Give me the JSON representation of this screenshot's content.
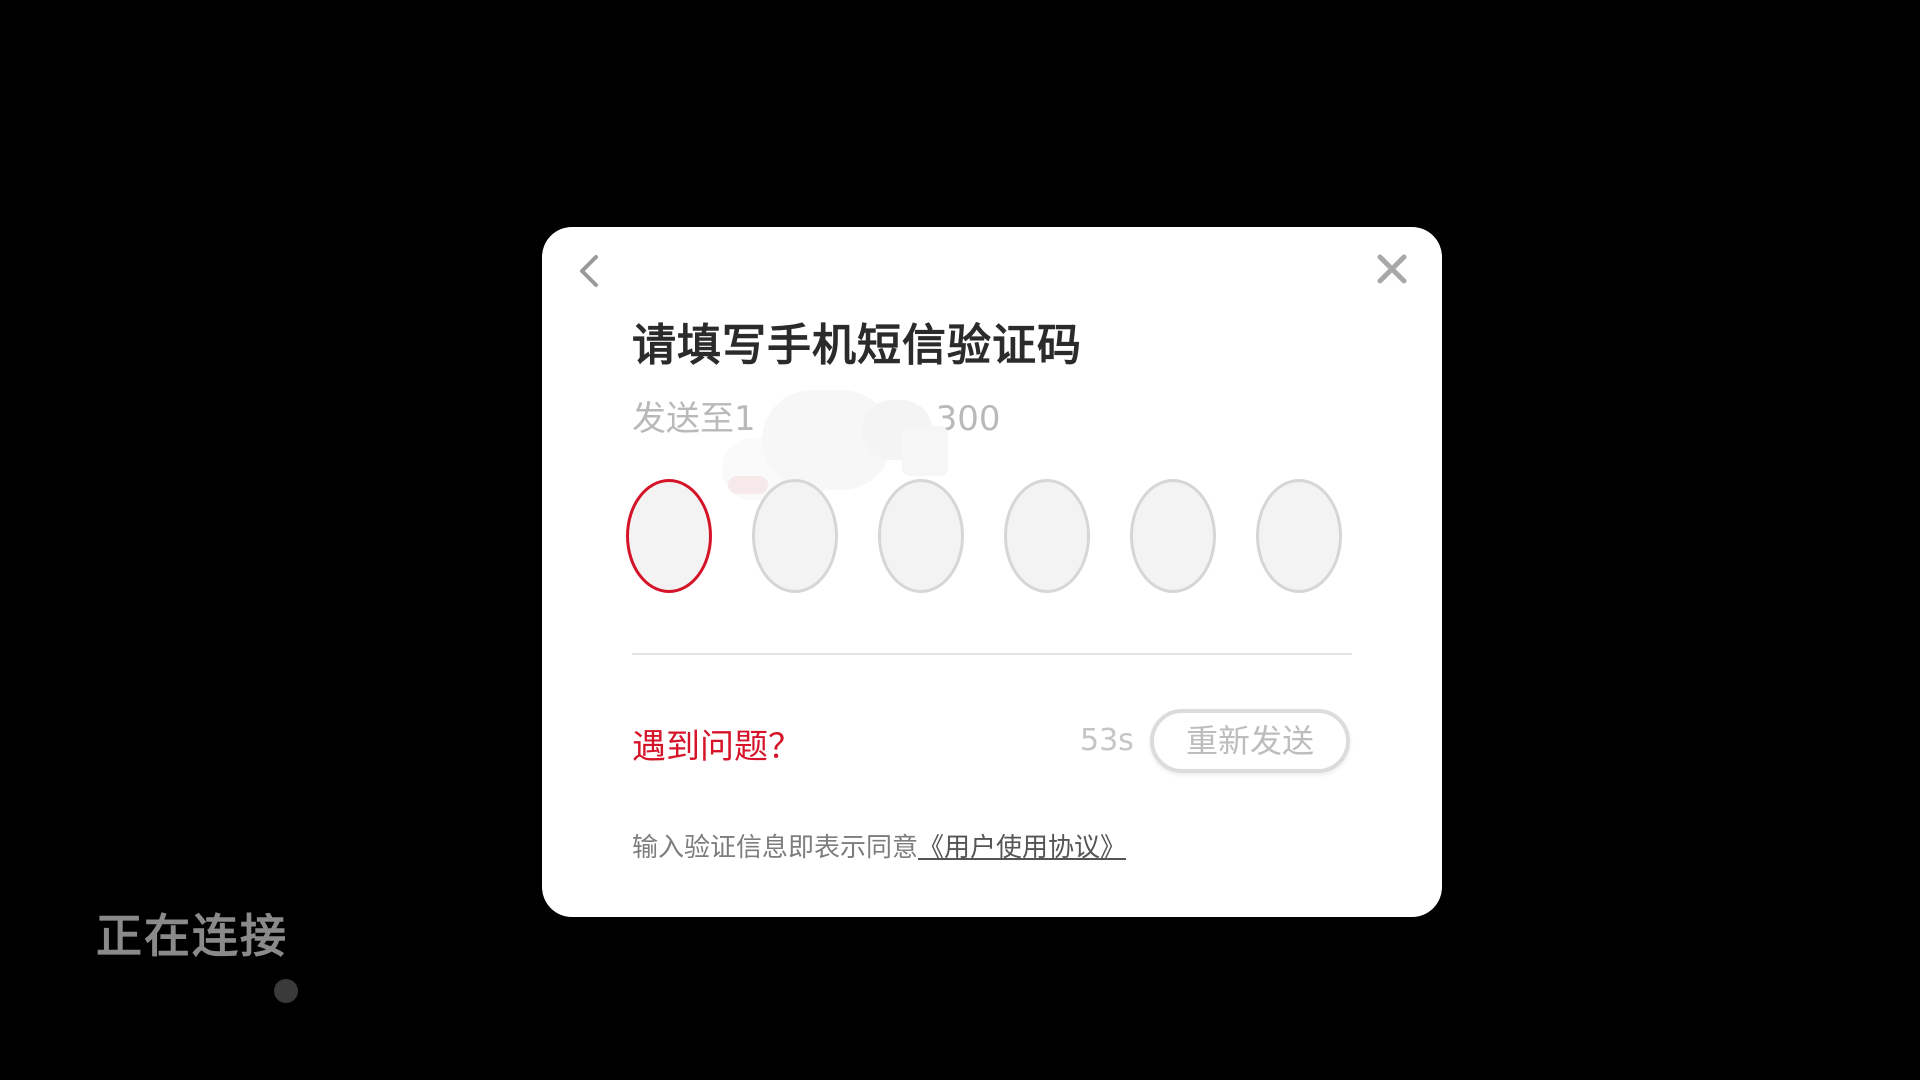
{
  "background": {
    "status_text": "正在连接"
  },
  "dialog": {
    "title": "请填写手机短信验证码",
    "subtitle": "发送至1",
    "subtitle_tail": "300",
    "code_length": 6,
    "active_index": 0,
    "help_link": "遇到问题？",
    "countdown": "53s",
    "resend_label": "重新发送",
    "agreement_text": "输入验证信息即表示同意",
    "agreement_link": "《用户使用协议》",
    "icons": {
      "back": "chevron-left-icon",
      "close": "close-icon"
    }
  },
  "colors": {
    "accent": "#d5142a",
    "background": "#000000",
    "dialog": "#ffffff"
  }
}
